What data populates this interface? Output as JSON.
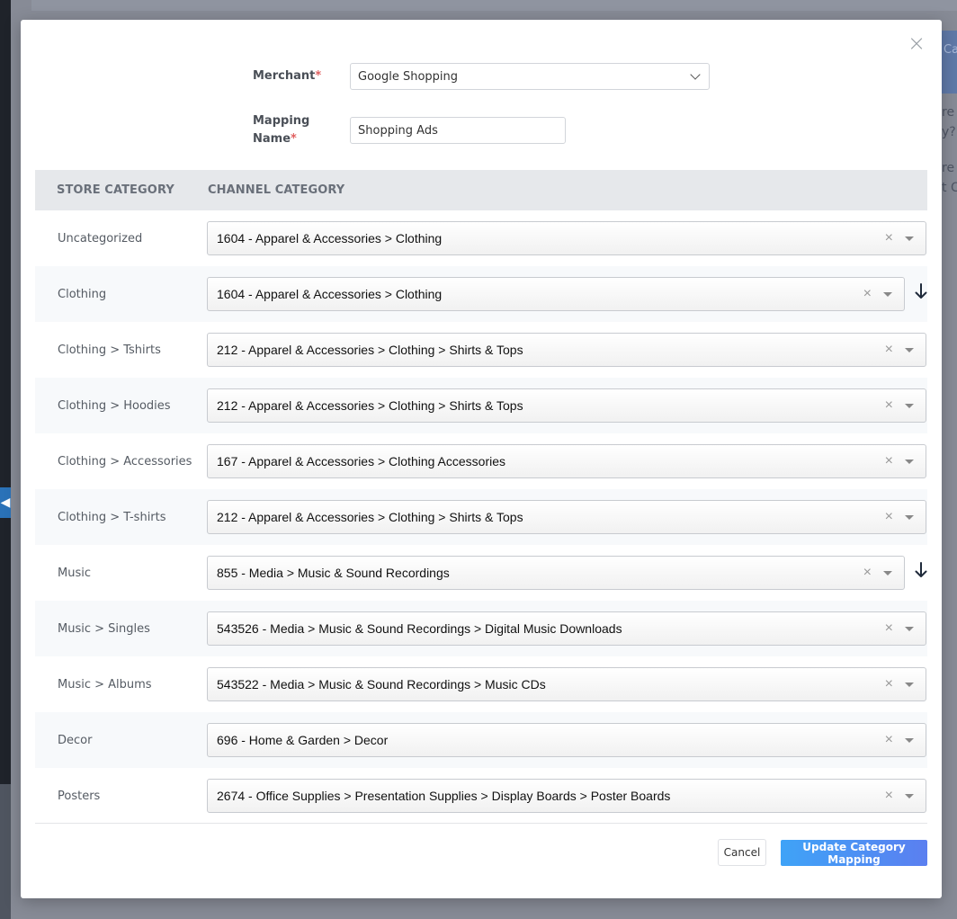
{
  "background": {
    "sidebar_toggle_icon": "chevron-left-icon",
    "right_card_text": "Ca",
    "right_text_lines": [
      "re (",
      "y?",
      "re",
      "t C"
    ]
  },
  "modal": {
    "close_icon": "close-icon",
    "close_glyph": "×",
    "merchant": {
      "label": "Merchant",
      "required_mark": "*",
      "value": "Google Shopping"
    },
    "mapping_name": {
      "label_line1": "Mapping",
      "label_line2": "Name",
      "required_mark": "*",
      "value": "Shopping Ads"
    },
    "table": {
      "headers": {
        "store": "STORE CATEGORY",
        "channel": "CHANNEL CATEGORY"
      },
      "clear_glyph": "×",
      "rows": [
        {
          "store": "Uncategorized",
          "channel": "1604 - Apparel & Accessories > Clothing",
          "copy_down": false
        },
        {
          "store": "Clothing",
          "channel": "1604 - Apparel & Accessories > Clothing",
          "copy_down": true
        },
        {
          "store": "Clothing > Tshirts",
          "channel": "212 - Apparel & Accessories > Clothing > Shirts & Tops",
          "copy_down": false
        },
        {
          "store": "Clothing > Hoodies",
          "channel": "212 - Apparel & Accessories > Clothing > Shirts & Tops",
          "copy_down": false
        },
        {
          "store": "Clothing > Accessories",
          "channel": "167 - Apparel & Accessories > Clothing Accessories",
          "copy_down": false
        },
        {
          "store": "Clothing > T-shirts",
          "channel": "212 - Apparel & Accessories > Clothing > Shirts & Tops",
          "copy_down": false
        },
        {
          "store": "Music",
          "channel": "855 - Media > Music & Sound Recordings",
          "copy_down": true
        },
        {
          "store": "Music > Singles",
          "channel": "543526 - Media > Music & Sound Recordings > Digital Music Downloads",
          "copy_down": false
        },
        {
          "store": "Music > Albums",
          "channel": "543522 - Media > Music & Sound Recordings > Music CDs",
          "copy_down": false
        },
        {
          "store": "Decor",
          "channel": "696 - Home & Garden > Decor",
          "copy_down": false
        },
        {
          "store": "Posters",
          "channel": "2674 - Office Supplies > Presentation Supplies > Display Boards > Poster Boards",
          "copy_down": false
        }
      ]
    },
    "buttons": {
      "cancel": "Cancel",
      "update": "Update Category Mapping"
    },
    "colors": {
      "primary_gradient_start": "#3fa3f7",
      "primary_gradient_end": "#5b7ff0",
      "required": "#e06060"
    }
  }
}
